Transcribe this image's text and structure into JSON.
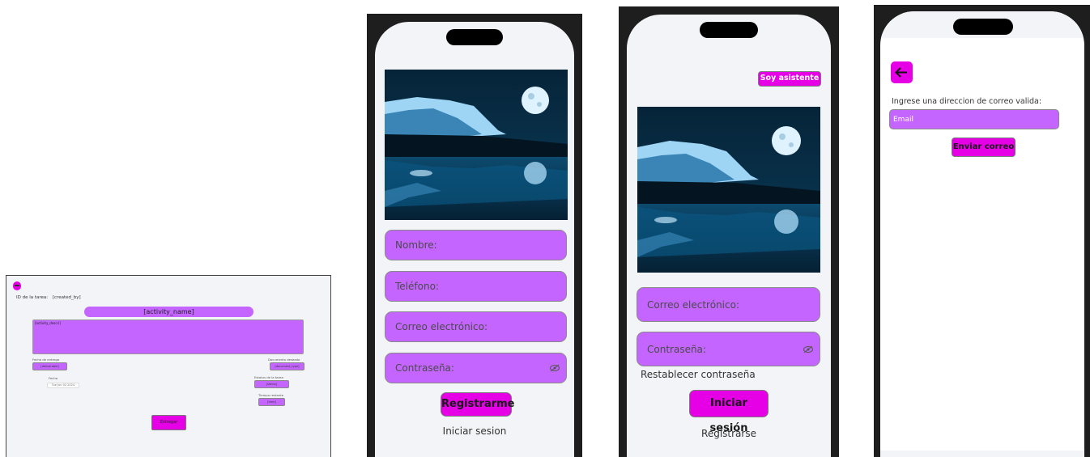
{
  "colors": {
    "accent": "#e500e5",
    "field_fill": "#c565ff",
    "screen_bg": "#f2f4f7",
    "phone_frame": "#1e1e1e"
  },
  "task_screen": {
    "back_icon": "arrow-left-icon",
    "id_label": "ID de la tarea:",
    "created_by": "[created_by]",
    "activity_name": "[activity_name]",
    "activity_description": "[activity_descri]",
    "delivery_label": "Fecha de entrega",
    "delivery_value": "[deliverable]",
    "date_label": "Fecha",
    "date_value": "Tue Jun 02 2024",
    "document_label": "Documento deseado",
    "document_value": "[document_type]",
    "status_label": "Estatus de la tarea",
    "status_value": "[status]",
    "time_label": "Tiempo restante",
    "time_value": "[time]",
    "submit_button": "Entregar"
  },
  "register_screen": {
    "image": "mountain-lake-moon-photo",
    "name_placeholder": "Nombre:",
    "phone_placeholder": "Teléfono:",
    "email_placeholder": "Correo electrónico:",
    "password_placeholder": "Contraseña:",
    "password_icon": "eye-off-icon",
    "register_button": "Registrarme",
    "login_link": "Iniciar sesion"
  },
  "login_screen": {
    "assistant_button": "Soy asistente",
    "image": "mountain-lake-moon-photo",
    "email_placeholder": "Correo electrónico:",
    "password_placeholder": "Contraseña:",
    "password_icon": "eye-off-icon",
    "reset_link": "Restablecer contraseña",
    "login_button": "Iniciar sesión",
    "register_link": "Registrarse"
  },
  "reset_screen": {
    "back_icon": "arrow-left-icon",
    "instruction": "Ingrese una direccion de correo valida:",
    "email_placeholder": "Email",
    "send_button": "Enviar correo"
  }
}
